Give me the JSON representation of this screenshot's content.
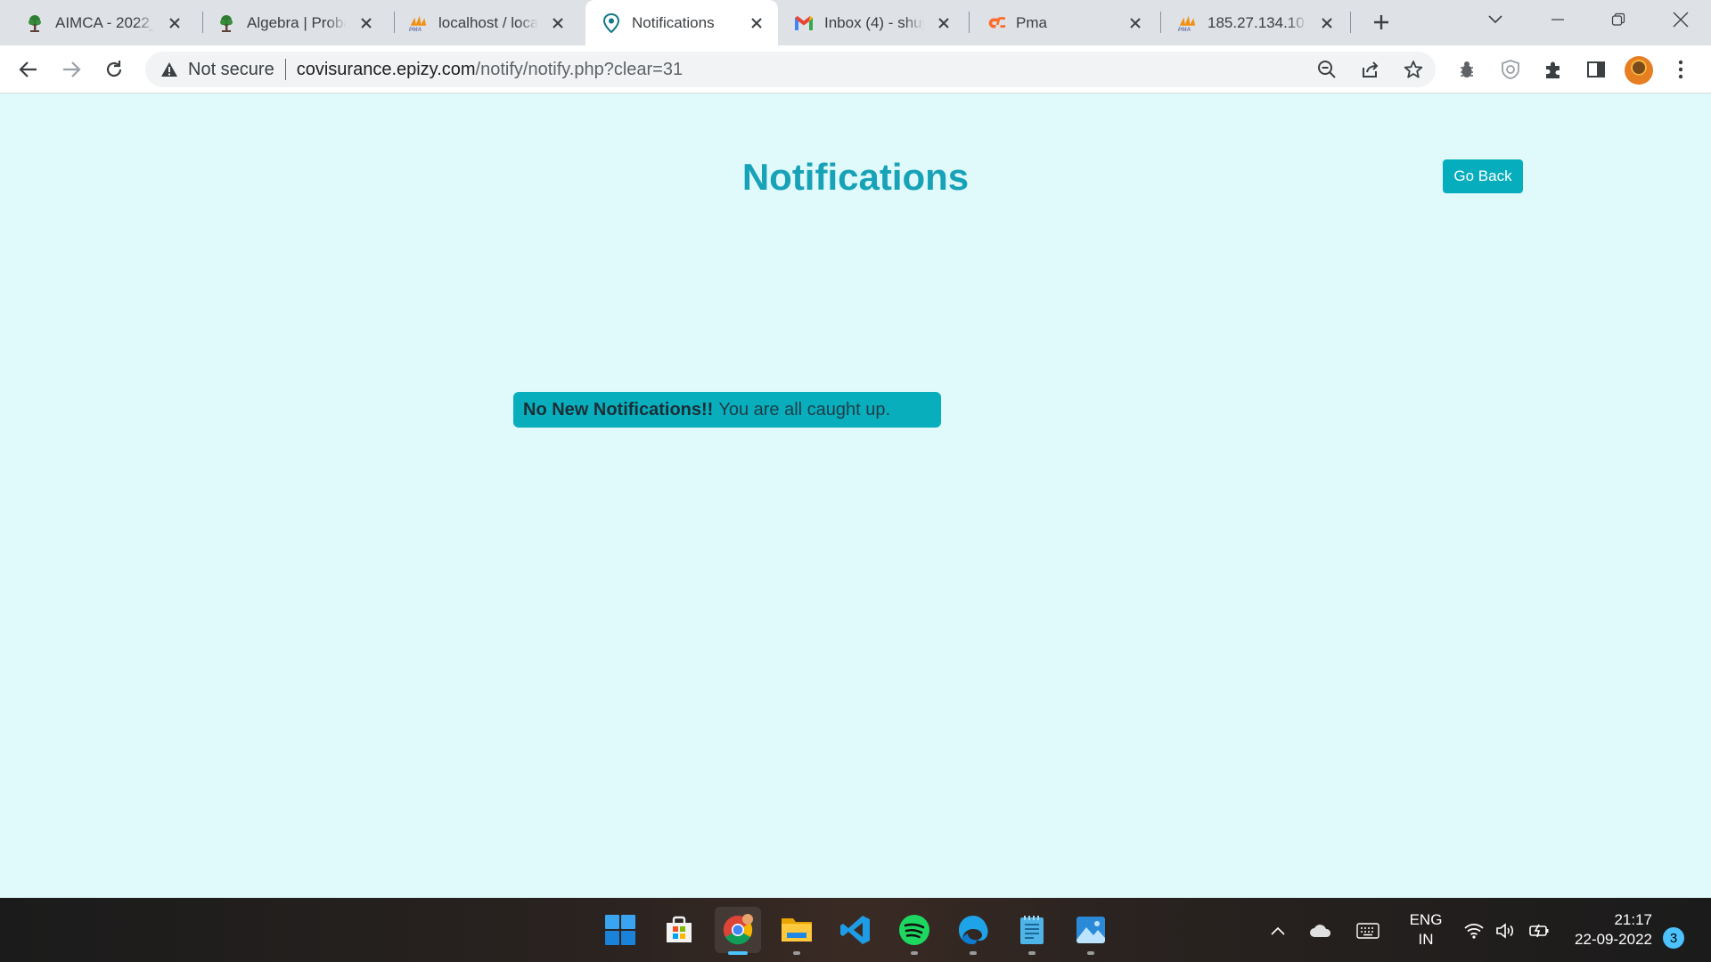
{
  "browser": {
    "tabs": [
      {
        "title": "AIMCA - 2022_",
        "icon": "tree-logo-icon",
        "active": false
      },
      {
        "title": "Algebra | Proba",
        "icon": "tree-logo-icon",
        "active": false
      },
      {
        "title": "localhost / loca",
        "icon": "phpmyadmin-icon",
        "active": false
      },
      {
        "title": "Notifications",
        "icon": "location-pin-icon",
        "active": true
      },
      {
        "title": "Inbox (4) - shuj",
        "icon": "gmail-icon",
        "active": false
      },
      {
        "title": "Pma",
        "icon": "cpanel-icon",
        "active": false
      },
      {
        "title": "185.27.134.10 /",
        "icon": "phpmyadmin-icon",
        "active": false
      }
    ],
    "address_bar": {
      "security_label": "Not secure",
      "url_host": "covisurance.epizy.com",
      "url_path": "/notify/notify.php?clear=31"
    }
  },
  "page": {
    "title": "Notifications",
    "go_back_label": "Go Back",
    "alert": {
      "strong": "No New Notifications!!",
      "text": "You are all caught up."
    }
  },
  "taskbar": {
    "apps": [
      "start-icon",
      "microsoft-store-icon",
      "chrome-icon",
      "file-explorer-icon",
      "vscode-icon",
      "spotify-icon",
      "edge-beta-icon",
      "notepad-icon",
      "photos-icon"
    ],
    "language": "ENG",
    "region": "IN",
    "time": "21:17",
    "date": "22-09-2022",
    "notification_count": "3"
  },
  "colors": {
    "page_background": "#e0fafb",
    "title": "#17a2b8",
    "button": "#06aebd",
    "alert": "#09aebd"
  }
}
